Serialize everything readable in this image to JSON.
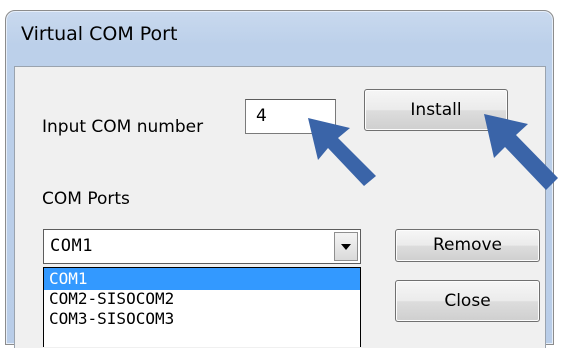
{
  "window": {
    "title": "Virtual COM Port"
  },
  "form": {
    "input_label": "Input COM number",
    "input_value": "4",
    "ports_label": "COM Ports"
  },
  "buttons": {
    "install": "Install",
    "remove": "Remove",
    "close": "Close"
  },
  "combo": {
    "selected": "COM1",
    "options": [
      "COM1",
      "COM2-SISOCOM2",
      "COM3-SISOCOM3"
    ],
    "highlighted_index": 0
  },
  "annotations": {
    "arrow_color": "#3a64a8",
    "highlight_color": "#3399ff"
  }
}
